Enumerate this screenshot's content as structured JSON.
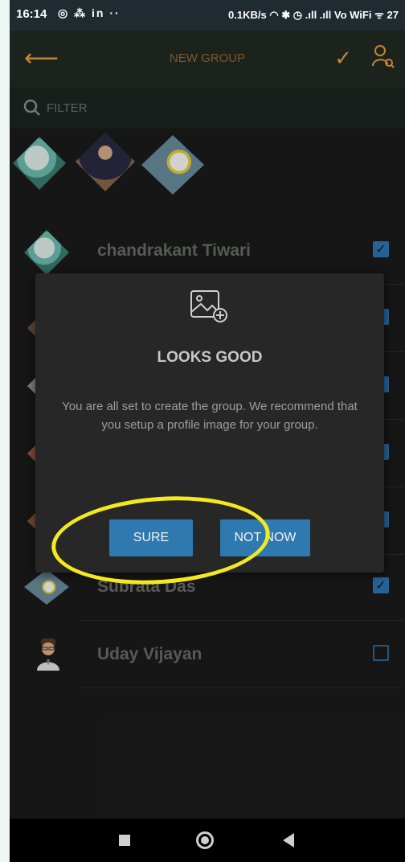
{
  "status_bar": {
    "time": "16:14",
    "left_icons": "◎ ⁂ in ··",
    "right_text": "0.1KB/s ◠ ✱ ◷ .ıll .ıll Vo WiFi ᯤ 27"
  },
  "app_bar": {
    "title": "NEW GROUP",
    "back_icon": "back-arrow-icon",
    "confirm_icon": "check-icon",
    "contacts_icon": "person-search-icon",
    "accent_color": "#f2a03a"
  },
  "filter": {
    "label": "FILTER"
  },
  "contacts": [
    {
      "name": "chandrakant Tiwari",
      "checked": true
    },
    {
      "name": "",
      "checked": true
    },
    {
      "name": "",
      "checked": true
    },
    {
      "name": "",
      "checked": true
    },
    {
      "name": "",
      "checked": true
    },
    {
      "name": "Subrata Das",
      "checked": true
    },
    {
      "name": "Uday Vijayan",
      "checked": false
    }
  ],
  "dialog": {
    "title": "LOOKS GOOD",
    "message": "You are all set to create the group. We recommend that you setup a profile image for your group.",
    "primary_button": "SURE",
    "secondary_button": "NOT NOW",
    "button_color": "#2e79b0"
  },
  "annotation": {
    "color": "#f3ea1e"
  }
}
